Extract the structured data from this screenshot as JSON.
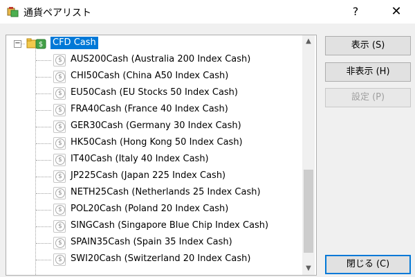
{
  "window": {
    "title": "通貨ペアリスト",
    "help_label": "?",
    "close_label": "✕"
  },
  "tree": {
    "expander_symbol": "−",
    "root_label": "CFD Cash",
    "icon_symbol": "$",
    "items": [
      "AUS200Cash  (Australia 200 Index Cash)",
      "CHI50Cash  (China A50 Index Cash)",
      "EU50Cash  (EU Stocks 50 Index Cash)",
      "FRA40Cash  (France 40 Index Cash)",
      "GER30Cash  (Germany 30 Index Cash)",
      "HK50Cash  (Hong Kong 50 Index Cash)",
      "IT40Cash  (Italy 40 Index Cash)",
      "JP225Cash  (Japan 225 Index Cash)",
      "NETH25Cash  (Netherlands 25 Index Cash)",
      "POL20Cash  (Poland 20 Index Cash)",
      "SINGCash  (Singapore Blue Chip Index Cash)",
      "SPAIN35Cash  (Spain 35 Index Cash)",
      "SWI20Cash  (Switzerland 20 Index Cash)"
    ],
    "scroll_up_symbol": "▲",
    "scroll_down_symbol": "▼"
  },
  "buttons": {
    "show": "表示 (S)",
    "hide": "非表示 (H)",
    "settings": "設定 (P)",
    "close": "閉じる (C)"
  },
  "colors": {
    "selection": "#0078d7",
    "window_bg": "#f0f0f0"
  }
}
